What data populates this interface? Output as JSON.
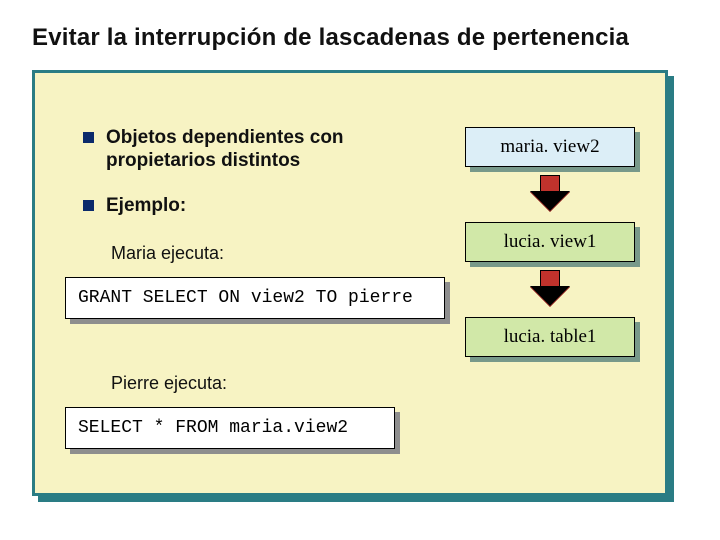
{
  "title": "Evitar la interrupción de lascadenas de pertenencia",
  "bullets": {
    "b1": "Objetos dependientes con propietarios distintos",
    "b2": "Ejemplo:"
  },
  "labels": {
    "maria": "Maria ejecuta:",
    "pierre": "Pierre ejecuta:"
  },
  "code": {
    "grant": "GRANT SELECT ON view2 TO pierre",
    "select": "SELECT * FROM maria.view2"
  },
  "objects": {
    "o1": "maria. view2",
    "o2": "lucia. view1",
    "o3": "lucia. table1"
  }
}
